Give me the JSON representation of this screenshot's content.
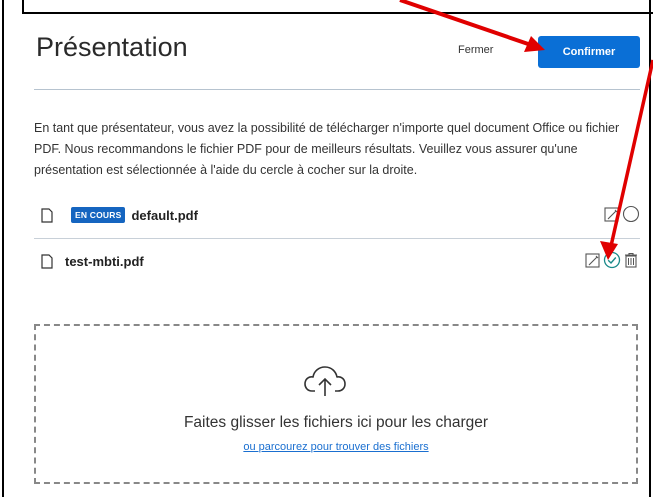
{
  "dialog": {
    "title": "Présentation",
    "close_label": "Fermer",
    "confirm_label": "Confirmer",
    "description": "En tant que présentateur, vous avez la possibilité de télécharger n'importe quel document Office ou fichier PDF. Nous recommandons le fichier PDF pour de meilleurs résultats. Veuillez vous assurer qu'une présentation est sélectionnée à l'aide du cercle à cocher sur la droite."
  },
  "files": [
    {
      "name": "default.pdf",
      "badge": "EN COURS",
      "selected": false,
      "deletable": false
    },
    {
      "name": "test-mbti.pdf",
      "badge": "",
      "selected": true,
      "deletable": true
    }
  ],
  "dropzone": {
    "text": "Faites glisser les fichiers ici pour les charger",
    "link": "ou parcourez pour trouver des fichiers"
  },
  "colors": {
    "accent": "#0a6fd6",
    "check": "#1a8a8a",
    "annotation": "#e00000"
  },
  "icons": [
    "document-icon",
    "edit-icon",
    "radio-icon",
    "check-circle-icon",
    "trash-icon",
    "cloud-upload-icon"
  ]
}
